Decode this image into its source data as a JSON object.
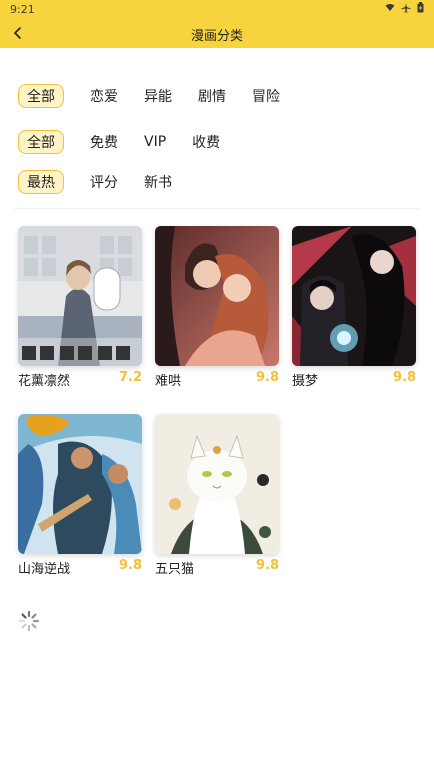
{
  "status": {
    "time": "9:21"
  },
  "header": {
    "title": "漫画分类"
  },
  "filters": {
    "genre": [
      "全部",
      "恋爱",
      "异能",
      "剧情",
      "冒险"
    ],
    "price": [
      "全部",
      "免费",
      "VIP",
      "收费"
    ],
    "sort": [
      "最热",
      "评分",
      "新书"
    ]
  },
  "comics": [
    {
      "title": "花薰凛然",
      "score": "7.2"
    },
    {
      "title": "难哄",
      "score": "9.8"
    },
    {
      "title": "摄梦",
      "score": "9.8"
    },
    {
      "title": "山海逆战",
      "score": "9.8"
    },
    {
      "title": "五只猫",
      "score": "9.8"
    }
  ],
  "colors": {
    "accent": "#f7d43d",
    "score": "#f2c13a"
  }
}
